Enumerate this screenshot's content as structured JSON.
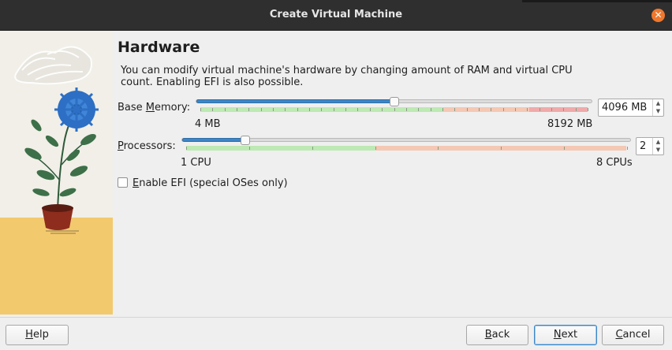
{
  "window": {
    "title": "Create Virtual Machine",
    "close_glyph": "✕"
  },
  "page": {
    "heading": "Hardware",
    "description": "You can modify virtual machine's hardware by changing amount of RAM and virtual CPU count. Enabling EFI is also possible."
  },
  "memory": {
    "label_pre": "Base ",
    "label_mnemonic": "M",
    "label_post": "emory:",
    "min_label": "4 MB",
    "max_label": "8192 MB",
    "value_text": "4096 MB",
    "value_fraction": 0.5
  },
  "processors": {
    "label_mnemonic": "P",
    "label_post": "rocessors:",
    "min_label": "1 CPU",
    "max_label": "8 CPUs",
    "value_text": "2",
    "value": 2,
    "min": 1,
    "max": 8
  },
  "efi": {
    "label_mnemonic": "E",
    "label_post": "nable EFI (special OSes only)",
    "checked": false
  },
  "footer": {
    "help_mnemonic": "H",
    "help_post": "elp",
    "back_mnemonic": "B",
    "back_post": "ack",
    "next_mnemonic": "N",
    "next_post": "ext",
    "cancel_mnemonic": "C",
    "cancel_post": "ancel"
  },
  "colors": {
    "accent": "#3d86c6",
    "zone_good": "#bde9b4",
    "zone_warn": "#f5c8b4",
    "zone_bad": "#f0aaaa",
    "close_button": "#f0782d"
  }
}
